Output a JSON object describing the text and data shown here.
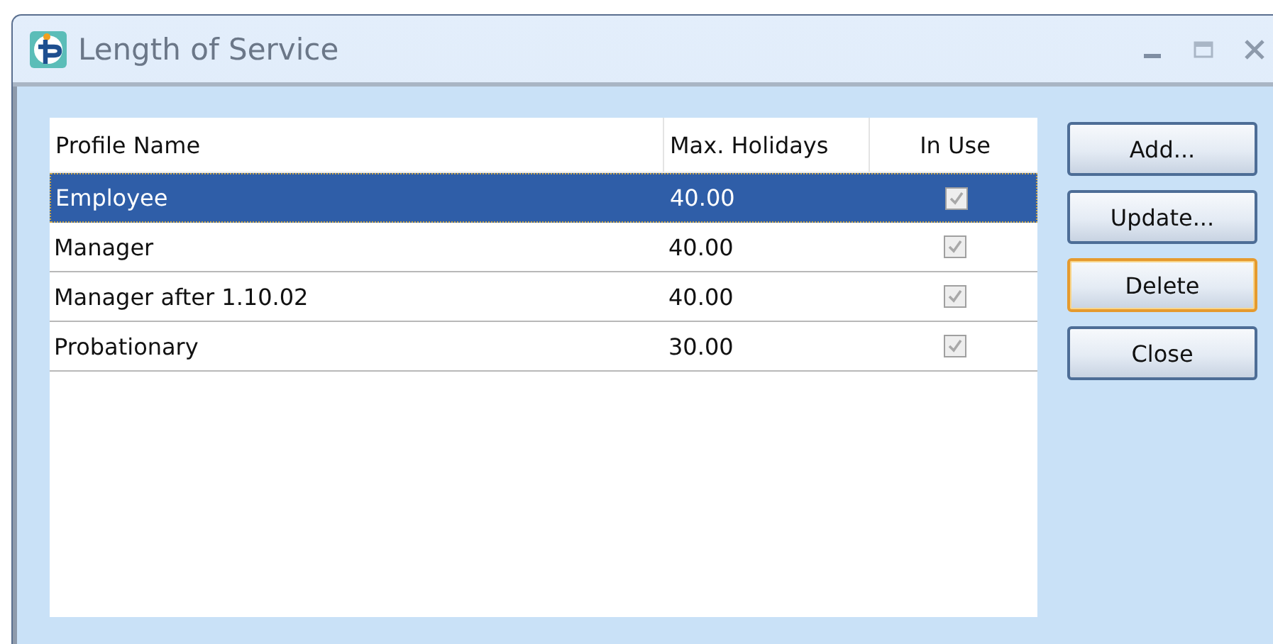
{
  "window": {
    "title": "Length of Service"
  },
  "table": {
    "columns": [
      "Profile Name",
      "Max. Holidays",
      "In Use"
    ],
    "rows": [
      {
        "name": "Employee",
        "max_holidays": "40.00",
        "in_use": true,
        "selected": true
      },
      {
        "name": "Manager",
        "max_holidays": "40.00",
        "in_use": true,
        "selected": false
      },
      {
        "name": "Manager after 1.10.02",
        "max_holidays": "40.00",
        "in_use": true,
        "selected": false
      },
      {
        "name": "Probationary",
        "max_holidays": "30.00",
        "in_use": true,
        "selected": false
      }
    ]
  },
  "buttons": [
    {
      "label": "Add...",
      "focused": false
    },
    {
      "label": "Update...",
      "focused": false
    },
    {
      "label": "Delete",
      "focused": true
    },
    {
      "label": "Close",
      "focused": false
    }
  ]
}
